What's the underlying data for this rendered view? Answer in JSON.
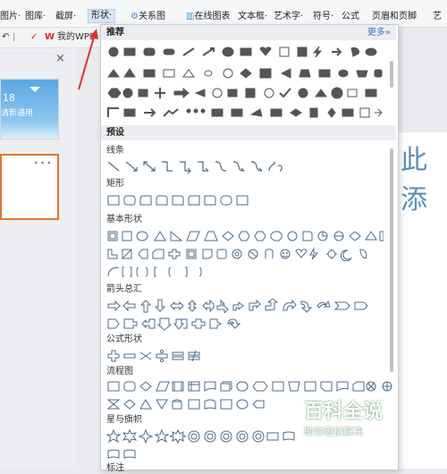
{
  "ribbon": {
    "items": [
      {
        "label": "图片·"
      },
      {
        "label": "图库·"
      },
      {
        "label": "截屏·"
      },
      {
        "label": "形状·"
      },
      {
        "label": "关系图"
      },
      {
        "label": "在线图表"
      },
      {
        "label": "文本框·"
      },
      {
        "label": "艺术字·"
      },
      {
        "label": "符号·"
      },
      {
        "label": "公式"
      },
      {
        "label": "页眉和页脚"
      },
      {
        "label": "艺"
      }
    ]
  },
  "quickbar": {
    "wps_label": "我的WPS"
  },
  "slide_thumb": {
    "number": "18",
    "text": "清新通用"
  },
  "canvas": {
    "title_text": "此添"
  },
  "dropdown": {
    "recommend_header": "推荐",
    "more_link": "更多»",
    "preset_header": "预设",
    "sections": [
      "线条",
      "矩形",
      "基本形状",
      "箭头总汇",
      "公式形状",
      "流程图",
      "星与旗帜",
      "标注"
    ]
  },
  "watermark": {
    "brand": "百科全说",
    "slogan": "助你轻松解决"
  },
  "colors": {
    "accent": "#e2782e",
    "link": "#3a78c3",
    "arrow": "#e0302e"
  }
}
